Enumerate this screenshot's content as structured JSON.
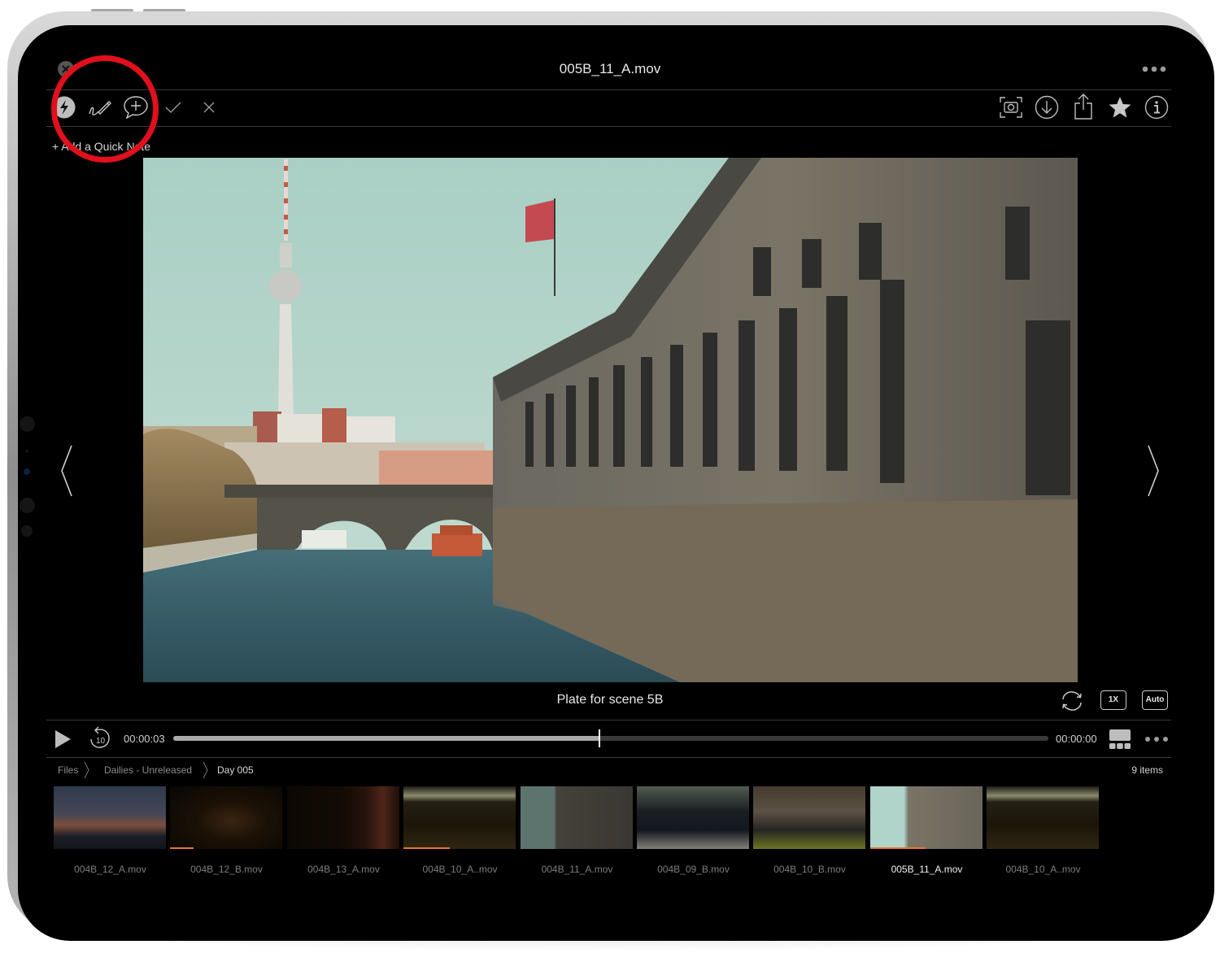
{
  "header": {
    "title": "005B_11_A.mov",
    "more_icon": "ellipsis-horizontal"
  },
  "toolbar": {
    "left_icons": [
      "lightning-icon",
      "signature-pen-icon",
      "add-comment-icon",
      "checkmark-icon",
      "close-x-icon"
    ],
    "right_icons": [
      "screenshot-camera-icon",
      "download-icon",
      "share-icon",
      "star-icon",
      "info-icon"
    ]
  },
  "quick_note": {
    "label": "+ Add a Quick Note"
  },
  "annotation": {
    "ring_color": "#e0101c"
  },
  "video": {
    "caption": "Plate for scene 5B",
    "prev_icon": "chevron-left-icon",
    "next_icon": "chevron-right-icon"
  },
  "playback_options": {
    "loop_icon": "loop-icon",
    "speed_label": "1X",
    "quality_label": "Auto"
  },
  "player": {
    "current_time": "00:00:03",
    "remaining_time": "00:00:00",
    "progress": 0.487,
    "play_icon": "play-icon",
    "skip_back_label": "10",
    "layout_icon": "filmstrip-layout-icon",
    "more_icon": "ellipsis-horizontal"
  },
  "breadcrumb": {
    "items": [
      "Files",
      "Dailies - Unreleased",
      "Day 005"
    ],
    "count_label": "9 items"
  },
  "filmstrip": {
    "accent_color": "#e8772b",
    "items": [
      {
        "label": "004B_12_A.mov",
        "progress": 0,
        "active": false
      },
      {
        "label": "004B_12_B.mov",
        "progress": 0.21,
        "active": false
      },
      {
        "label": "004B_13_A.mov",
        "progress": 0,
        "active": false
      },
      {
        "label": "004B_10_A..mov",
        "progress": 0.41,
        "active": false
      },
      {
        "label": "004B_11_A.mov",
        "progress": 0,
        "active": false
      },
      {
        "label": "004B_09_B.mov",
        "progress": 0,
        "active": false
      },
      {
        "label": "004B_10_B.mov",
        "progress": 0,
        "active": false
      },
      {
        "label": "005B_11_A.mov",
        "progress": 0.49,
        "active": true
      },
      {
        "label": "004B_10_A..mov",
        "progress": 0,
        "active": false
      }
    ]
  }
}
